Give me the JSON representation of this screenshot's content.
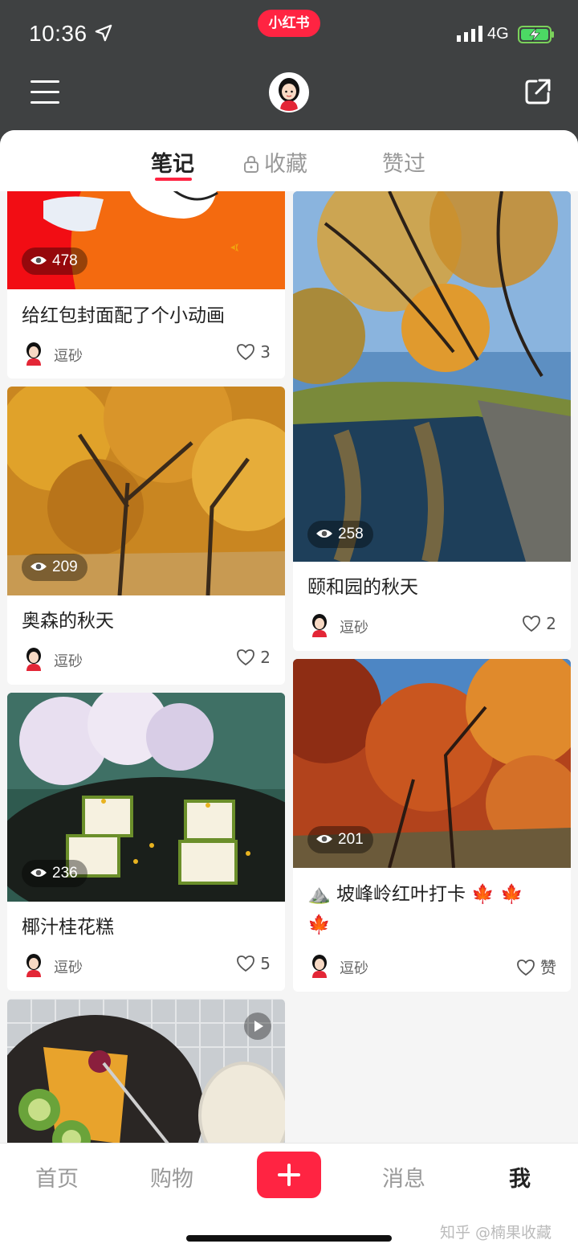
{
  "status_bar": {
    "time": "10:36",
    "network": "4G",
    "app_badge": "小红书"
  },
  "header": {
    "menu_icon": "menu-icon",
    "share_icon": "share-icon"
  },
  "tabs": [
    {
      "label": "笔记",
      "active": true
    },
    {
      "label": "收藏",
      "locked": true
    },
    {
      "label": "赞过"
    }
  ],
  "left_column": [
    {
      "title": "给红包封面配了个小动画",
      "views": "478",
      "author": "逗砂",
      "likes": "3"
    },
    {
      "title": "奥森的秋天",
      "views": "209",
      "author": "逗砂",
      "likes": "2"
    },
    {
      "title": "椰汁桂花糕",
      "views": "236",
      "author": "逗砂",
      "likes": "5"
    },
    {
      "title": "",
      "has_video": true
    }
  ],
  "right_column": [
    {
      "title": "颐和园的秋天",
      "views": "258",
      "author": "逗砂",
      "likes": "2"
    },
    {
      "title_line1": "⛰️ 坡峰岭红叶打卡 🍁 🍁",
      "title_line2": "🍁",
      "views": "201",
      "author": "逗砂",
      "likes": "赞"
    }
  ],
  "bottom_nav": [
    {
      "label": "首页"
    },
    {
      "label": "购物"
    },
    {
      "label": "add",
      "icon": "plus-icon"
    },
    {
      "label": "消息"
    },
    {
      "label": "我",
      "active": true
    }
  ],
  "watermark": "知乎 @楠果收藏",
  "colors": {
    "brand": "#ff2442",
    "header_bg": "#3f4142"
  }
}
